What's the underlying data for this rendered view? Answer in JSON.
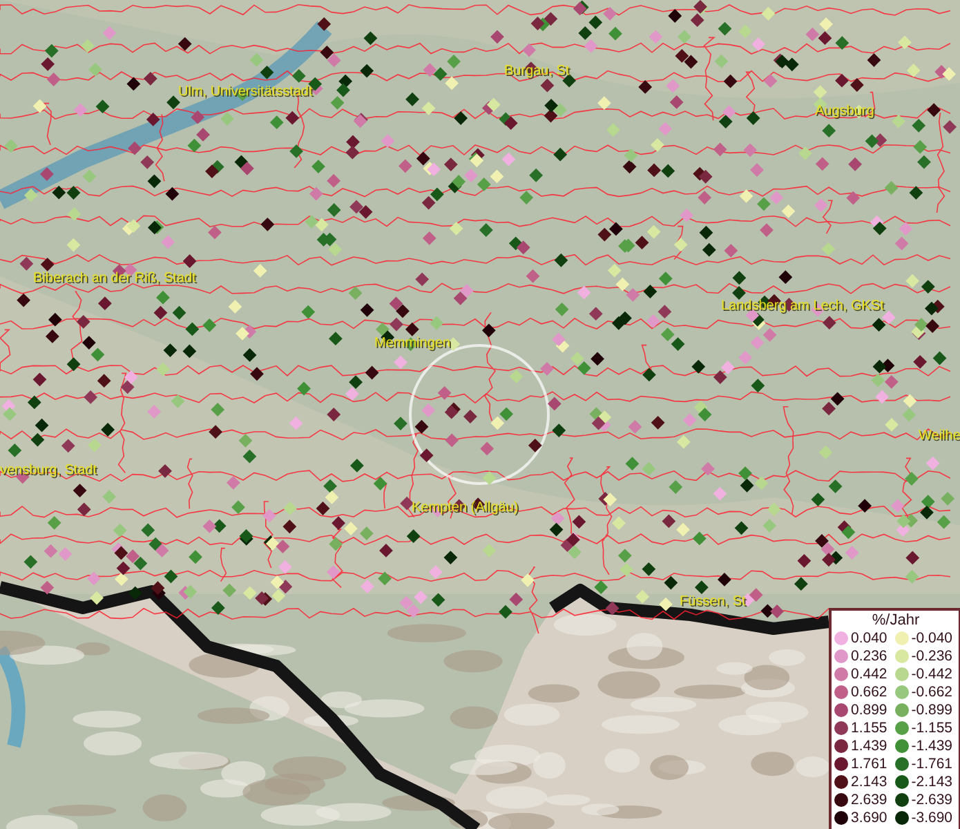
{
  "map": {
    "place_labels": [
      {
        "text": "Burgau, St"
      },
      {
        "text": "Ulm, Universitätsstadt"
      },
      {
        "text": "Augsburg"
      },
      {
        "text": "Biberach an der Riß, Stadt"
      },
      {
        "text": "Landsberg am Lech, GKSt"
      },
      {
        "text": "Memmingen"
      },
      {
        "text": "Weilhe"
      },
      {
        "text": "vensburg, Stadt"
      },
      {
        "text": "Kempten (Allgäu)"
      },
      {
        "text": "Füssen, St"
      }
    ],
    "legend": {
      "title": "%/Jahr",
      "positive": [
        {
          "value": "0.040",
          "color": "#f0b0e0"
        },
        {
          "value": "0.236",
          "color": "#e098c8"
        },
        {
          "value": "0.442",
          "color": "#d07aa8"
        },
        {
          "value": "0.662",
          "color": "#c06088"
        },
        {
          "value": "0.899",
          "color": "#a84870"
        },
        {
          "value": "1.155",
          "color": "#903858"
        },
        {
          "value": "1.439",
          "color": "#7a2840"
        },
        {
          "value": "1.761",
          "color": "#6a1830"
        },
        {
          "value": "2.143",
          "color": "#501018"
        },
        {
          "value": "2.639",
          "color": "#380810"
        },
        {
          "value": "3.690",
          "color": "#200008"
        }
      ],
      "negative": [
        {
          "value": "-0.040",
          "color": "#f0f0b0"
        },
        {
          "value": "-0.236",
          "color": "#d8e8a0"
        },
        {
          "value": "-0.442",
          "color": "#b8d890"
        },
        {
          "value": "-0.662",
          "color": "#98c880"
        },
        {
          "value": "-0.899",
          "color": "#78b060"
        },
        {
          "value": "-1.155",
          "color": "#58a048"
        },
        {
          "value": "-1.439",
          "color": "#409038"
        },
        {
          "value": "-1.761",
          "color": "#287028"
        },
        {
          "value": "-2.143",
          "color": "#185818"
        },
        {
          "value": "-2.639",
          "color": "#104010"
        },
        {
          "value": "-3.690",
          "color": "#082808"
        }
      ]
    }
  }
}
